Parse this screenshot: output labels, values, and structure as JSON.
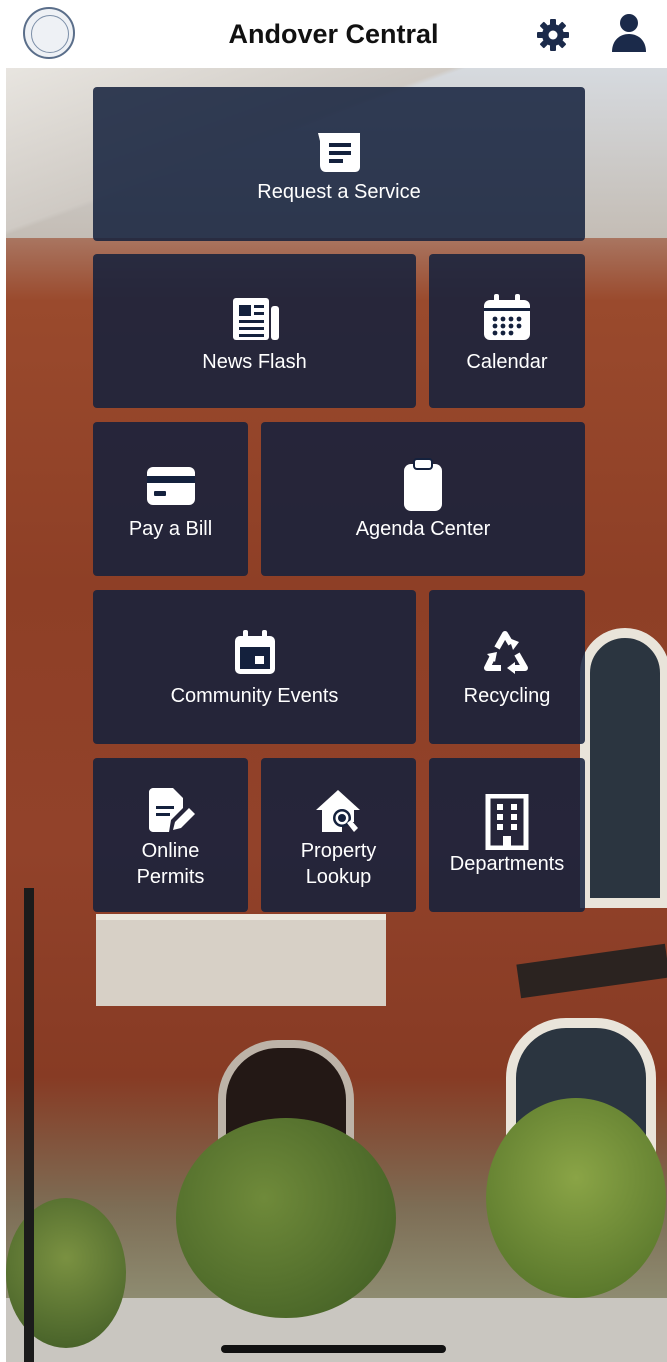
{
  "header": {
    "title": "Andover Central",
    "settings_icon": "gear-icon",
    "profile_icon": "user-icon",
    "seal_icon": "town-seal-logo"
  },
  "tiles": {
    "request_service": {
      "label": "Request a Service",
      "icon": "request-list-icon"
    },
    "news_flash": {
      "label": "News Flash",
      "icon": "newspaper-icon"
    },
    "calendar": {
      "label": "Calendar",
      "icon": "calendar-icon"
    },
    "pay_bill": {
      "label": "Pay a Bill",
      "icon": "credit-card-icon"
    },
    "agenda_center": {
      "label": "Agenda Center",
      "icon": "clipboard-icon"
    },
    "community_events": {
      "label": "Community Events",
      "icon": "calendar-event-icon"
    },
    "recycling": {
      "label": "Recycling",
      "icon": "recycle-icon"
    },
    "online_permits": {
      "label_line1": "Online",
      "label_line2": "Permits",
      "icon": "permit-document-icon"
    },
    "property_lookup": {
      "label_line1": "Property",
      "label_line2": "Lookup",
      "icon": "house-search-icon"
    },
    "departments": {
      "label": "Departments",
      "icon": "building-icon"
    }
  },
  "colors": {
    "tile_background": "#14213D",
    "header_background": "#FFFFFF",
    "header_text": "#111111",
    "header_icons": "#1B2A4A"
  }
}
